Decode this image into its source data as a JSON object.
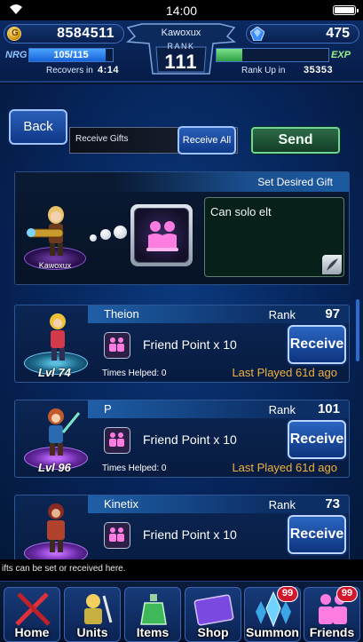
{
  "status_bar": {
    "time": "14:00"
  },
  "header": {
    "gil": "8584511",
    "lapis": "475",
    "player_name": "Kawoxux",
    "rank_label": "RANK",
    "rank": "111",
    "nrg_label": "NRG",
    "nrg_value": "105/115",
    "nrg_fraction": 0.913,
    "recovers_label": "Recovers in",
    "recovers_time": "4:14",
    "exp_label": "EXP",
    "exp_fraction": 0.23,
    "rank_up_label": "Rank Up in",
    "rank_up_value": "35353"
  },
  "toolbar": {
    "back_label": "Back",
    "receive_gifts_label": "Receive Gifts",
    "receive_all_label": "Receive All",
    "send_label": "Send"
  },
  "desired_gift": {
    "title": "Set Desired Gift",
    "hero_name": "Kawoxux",
    "note": "Can solo elt"
  },
  "friends": [
    {
      "name": "Theion",
      "rank_tag": "Rank",
      "rank": "97",
      "gift": "Friend Point x 10",
      "times_helped": "Times Helped: 0",
      "last_played": "Last Played 61d ago",
      "level": "Lvl 74",
      "receive_label": "Receive"
    },
    {
      "name": "P",
      "rank_tag": "Rank",
      "rank": "101",
      "gift": "Friend Point x 10",
      "times_helped": "Times Helped: 0",
      "last_played": "Last Played 61d ago",
      "level": "Lvl 96",
      "receive_label": "Receive"
    },
    {
      "name": "Kinetix",
      "rank_tag": "Rank",
      "rank": "73",
      "gift": "Friend Point x 10",
      "times_helped": "",
      "last_played": "",
      "level": "",
      "receive_label": "Receive"
    }
  ],
  "ticker": "ifts can be set or received here.",
  "nav": [
    {
      "label": "Home"
    },
    {
      "label": "Units"
    },
    {
      "label": "Items"
    },
    {
      "label": "Shop"
    },
    {
      "label": "Summon",
      "badge": "99"
    },
    {
      "label": "Friends",
      "badge": "99"
    }
  ],
  "colors": {
    "accent_blue": "#1664d8",
    "send_green": "#6fd59a",
    "last_played_orange": "#f0b23c",
    "badge_red": "#d2182d"
  }
}
